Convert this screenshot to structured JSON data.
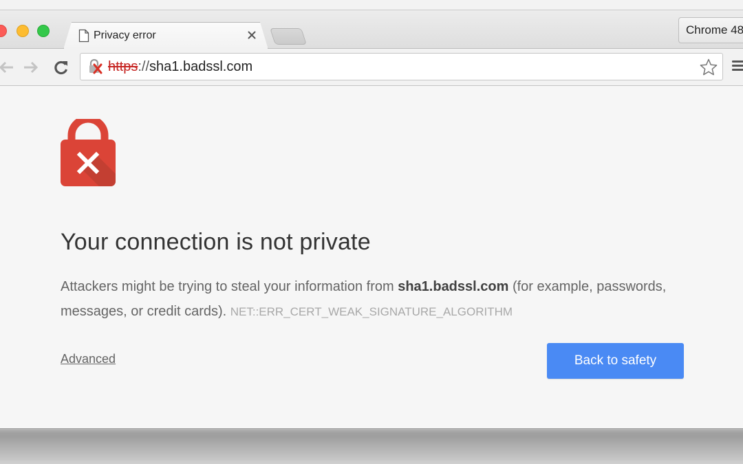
{
  "browser": {
    "tab": {
      "title": "Privacy error",
      "icon": "document-icon",
      "close_icon": "close-icon"
    },
    "profile_button": "Chrome 48",
    "toolbar": {
      "back_icon": "back-arrow-icon",
      "forward_icon": "forward-arrow-icon",
      "reload_icon": "reload-icon",
      "menu_icon": "hamburger-menu-icon"
    },
    "omnibox": {
      "security_icon": "broken-lock-icon",
      "scheme": "https",
      "separator": "://",
      "host": "sha1.badssl.com",
      "bookmark_icon": "star-icon"
    }
  },
  "page": {
    "icon": "red-lock-x-icon",
    "headline": "Your connection is not private",
    "message_prefix": "Attackers might be trying to steal your information from ",
    "message_host": "sha1.badssl.com",
    "message_suffix": " (for example, passwords, messages, or credit cards). ",
    "error_code": "NET::ERR_CERT_WEAK_SIGNATURE_ALGORITHM",
    "advanced_link": "Advanced",
    "primary_button": "Back to safety"
  },
  "colors": {
    "primary_button": "#4a8af4",
    "lock_red": "#db4437",
    "insecure_scheme": "#c5221f"
  }
}
